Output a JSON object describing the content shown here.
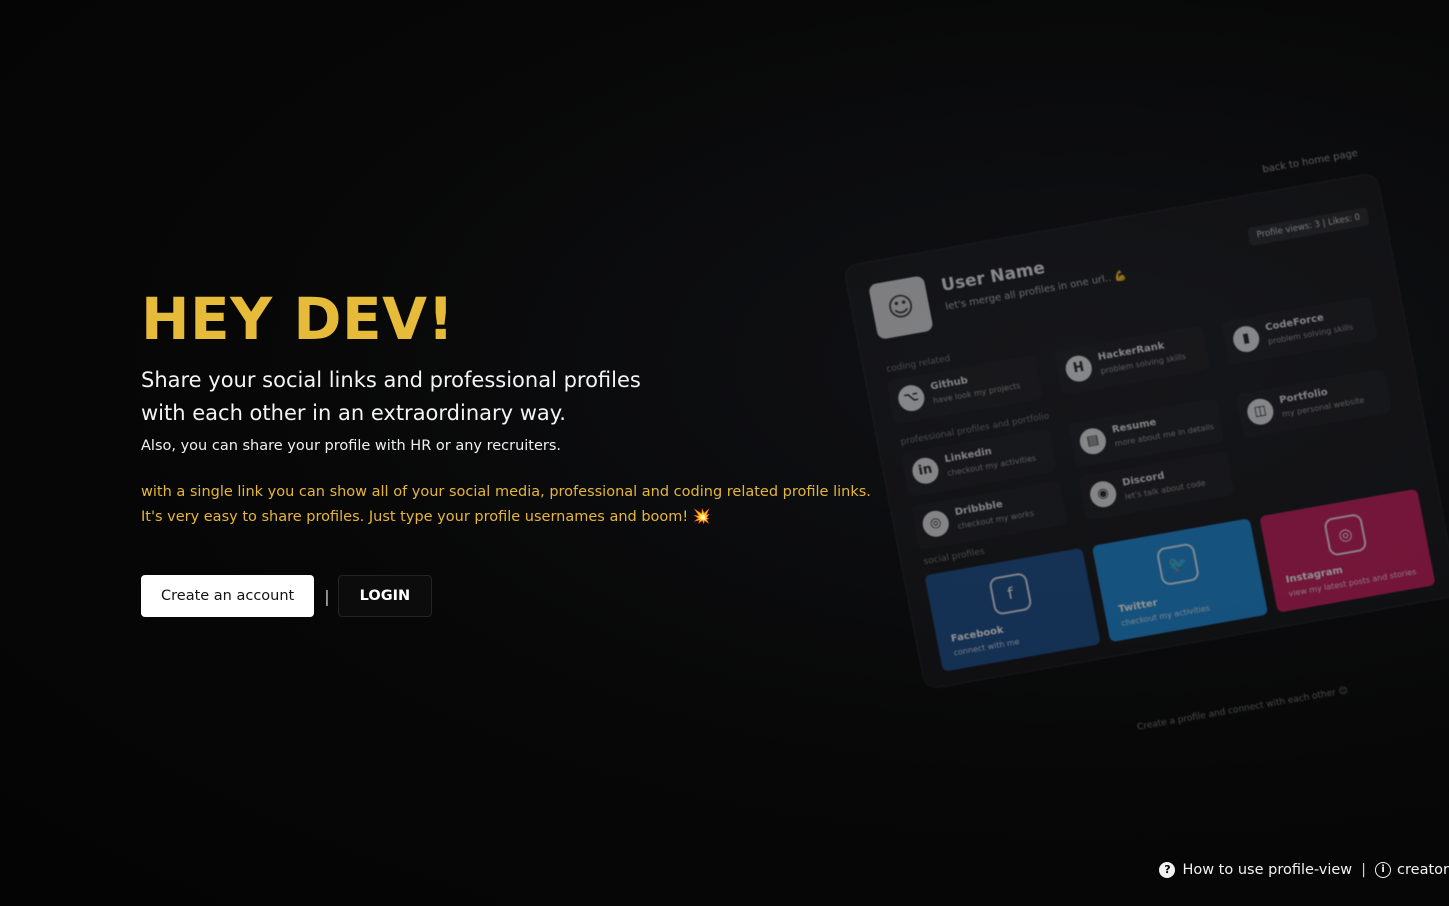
{
  "hero": {
    "title": "HEY DEV!",
    "subtitle": "Share your social links and professional profiles with each other in an extraordinary way.",
    "note": "Also, you can share your profile with HR or any recruiters.",
    "description": "with a single link you can show all of your social media, professional and coding related profile links. It's very easy to share profiles. Just type your profile usernames and boom! 💥"
  },
  "actions": {
    "create_label": "Create an account",
    "separator": "|",
    "login_label": "LOGIN"
  },
  "preview": {
    "back_link": "back to home page",
    "user_name": "User Name",
    "tagline": "let's merge all profiles in one url.. 💪",
    "stats": "Profile views: 3 | Likes: 0",
    "section_coding": "coding related",
    "section_professional": "professional profiles and portfolio",
    "section_social": "social profiles",
    "tiles": [
      {
        "icon": "github-icon",
        "glyph": "⌥",
        "title": "Github",
        "sub": "have look my projects"
      },
      {
        "icon": "hackerrank-icon",
        "glyph": "H",
        "title": "HackerRank",
        "sub": "problem solving skills"
      },
      {
        "icon": "codeforce-icon",
        "glyph": "▮",
        "title": "CodeForce",
        "sub": "problem solving skills"
      },
      {
        "icon": "linkedin-icon",
        "glyph": "in",
        "title": "Linkedin",
        "sub": "checkout my activities"
      },
      {
        "icon": "resume-icon",
        "glyph": "▤",
        "title": "Resume",
        "sub": "more about me in details"
      },
      {
        "icon": "portfolio-icon",
        "glyph": "◫",
        "title": "Portfolio",
        "sub": "my personal website"
      },
      {
        "icon": "dribbble-icon",
        "glyph": "◎",
        "title": "Dribbble",
        "sub": "checkout my works"
      },
      {
        "icon": "discord-icon",
        "glyph": "◉",
        "title": "Discord",
        "sub": "let's talk about code"
      }
    ],
    "socials": [
      {
        "icon": "facebook-icon",
        "glyph": "f",
        "title": "Facebook",
        "sub": "connect with me",
        "color": "#1b4d8c"
      },
      {
        "icon": "twitter-icon",
        "glyph": "🐦",
        "title": "Twitter",
        "sub": "checkout my activities",
        "color": "#1d8ad8"
      },
      {
        "icon": "instagram-icon",
        "glyph": "◎",
        "title": "Instagram",
        "sub": "view my latest posts and stories",
        "color": "#c81d5a"
      }
    ],
    "footer_note": "Create a profile and connect with each other 😊"
  },
  "footer": {
    "help_label": "How to use profile-view",
    "separator": "|",
    "creator_label": "creator"
  }
}
